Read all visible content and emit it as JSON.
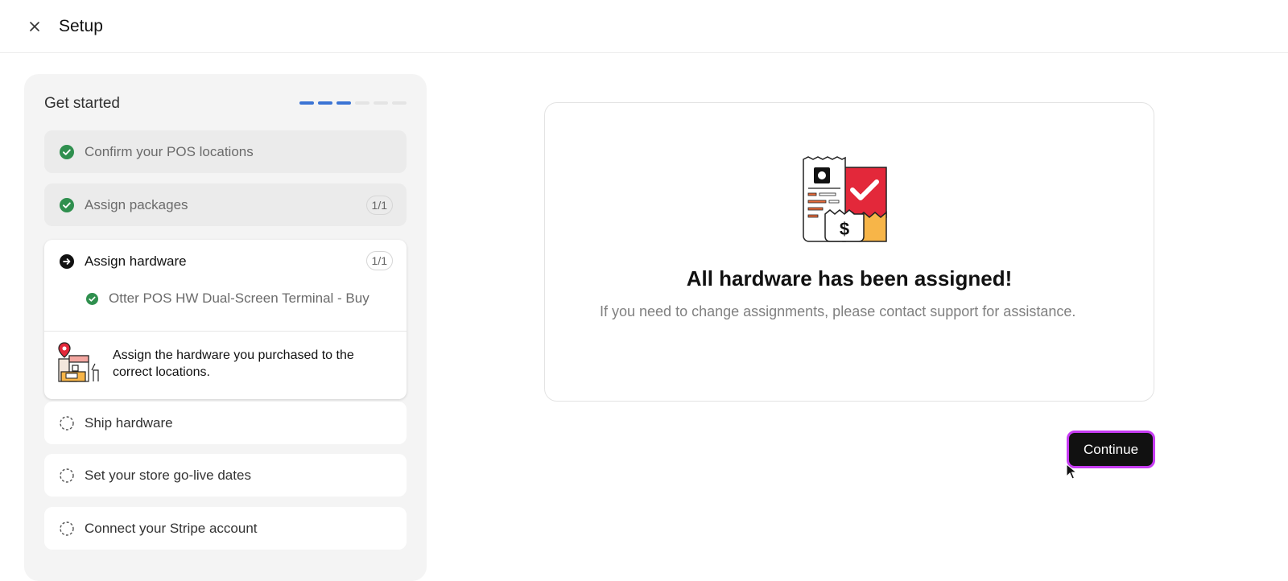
{
  "header": {
    "title": "Setup",
    "close_icon": "close-icon"
  },
  "sidebar": {
    "title": "Get started",
    "progress": {
      "total_segments": 6,
      "completed_segments": 3,
      "done_color": "#3b74d4"
    },
    "steps": [
      {
        "label": "Confirm your POS locations",
        "status": "completed",
        "icon": "check-circle-icon"
      },
      {
        "label": "Assign packages",
        "status": "completed",
        "icon": "check-circle-icon",
        "badge": "1/1"
      },
      {
        "label": "Assign hardware",
        "status": "active",
        "icon": "arrow-circle-icon",
        "badge": "1/1",
        "subitems": [
          {
            "label": "Otter POS HW Dual-Screen Terminal - Buy",
            "status": "completed",
            "icon": "check-circle-icon"
          }
        ],
        "hint": "Assign the hardware you purchased to the correct locations.",
        "hint_image": "hardware-location-illustration"
      },
      {
        "label": "Ship hardware",
        "status": "pending",
        "icon": "dashed-circle-icon"
      },
      {
        "label": "Set your store go-live dates",
        "status": "pending",
        "icon": "dashed-circle-icon"
      },
      {
        "label": "Connect your Stripe account",
        "status": "pending",
        "icon": "dashed-circle-icon"
      }
    ]
  },
  "main": {
    "illustration": "receipt-check-dollar-illustration",
    "title": "All hardware has been assigned!",
    "description": "If you need to change assignments, please contact support for assistance.",
    "continue_label": "Continue"
  },
  "colors": {
    "success_green": "#2f8f4e",
    "active_black": "#111111",
    "accent_red": "#e3283a",
    "accent_orange": "#f7b548",
    "focus_ring": "#c63bf2"
  }
}
